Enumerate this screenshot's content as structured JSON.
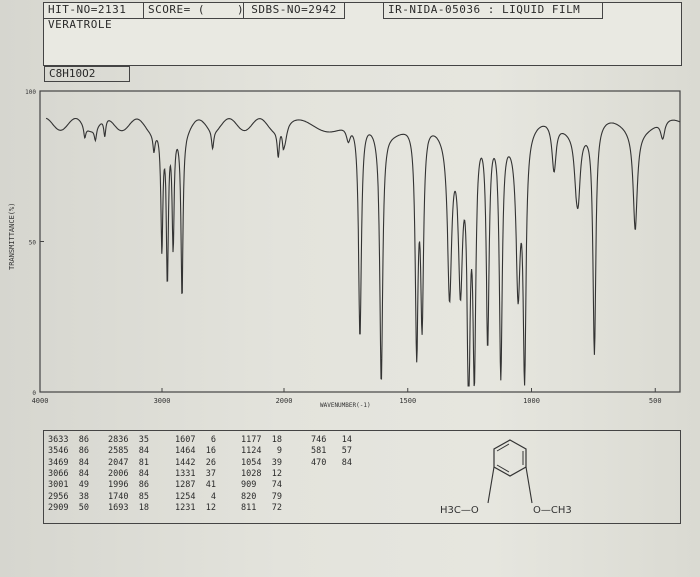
{
  "header": {
    "hit_no": "HIT-NO=2131",
    "score": "SCORE=  (",
    "sdbs": ") SDBS-NO=2942",
    "ir_nida": "IR-NIDA-05036 : LIQUID FILM",
    "compound": "VERATROLE",
    "formula": "C8H10O2"
  },
  "chart_data": {
    "type": "line",
    "xlabel": "WAVENUMBER(-1)",
    "ylabel": "TRANSMITTANCE(%)",
    "xlim": [
      4000,
      400
    ],
    "ylim": [
      0,
      100
    ],
    "x_ticks": [
      {
        "value": 4000,
        "label": "4000"
      },
      {
        "value": 3000,
        "label": "3000"
      },
      {
        "value": 2000,
        "label": "2000"
      },
      {
        "value": 1500,
        "label": "1500"
      },
      {
        "value": 1000,
        "label": "1000"
      },
      {
        "value": 500,
        "label": "500"
      }
    ],
    "y_ticks": [
      {
        "value": 100,
        "label": "100"
      },
      {
        "value": 50,
        "label": "50"
      },
      {
        "value": 0,
        "label": "0"
      }
    ],
    "peaks": [
      {
        "x": 3633,
        "y": 86
      },
      {
        "x": 3546,
        "y": 86
      },
      {
        "x": 3469,
        "y": 84
      },
      {
        "x": 3066,
        "y": 84
      },
      {
        "x": 3001,
        "y": 49
      },
      {
        "x": 2956,
        "y": 38
      },
      {
        "x": 2909,
        "y": 50
      },
      {
        "x": 2836,
        "y": 35
      },
      {
        "x": 2585,
        "y": 84
      },
      {
        "x": 2047,
        "y": 81
      },
      {
        "x": 2006,
        "y": 84
      },
      {
        "x": 1996,
        "y": 86
      },
      {
        "x": 1740,
        "y": 85
      },
      {
        "x": 1693,
        "y": 18
      },
      {
        "x": 1607,
        "y": 6
      },
      {
        "x": 1464,
        "y": 16
      },
      {
        "x": 1442,
        "y": 26
      },
      {
        "x": 1331,
        "y": 37
      },
      {
        "x": 1287,
        "y": 41
      },
      {
        "x": 1254,
        "y": 4
      },
      {
        "x": 1231,
        "y": 12
      },
      {
        "x": 1177,
        "y": 18
      },
      {
        "x": 1124,
        "y": 9
      },
      {
        "x": 1054,
        "y": 39
      },
      {
        "x": 1028,
        "y": 12
      },
      {
        "x": 909,
        "y": 74
      },
      {
        "x": 820,
        "y": 79
      },
      {
        "x": 811,
        "y": 72
      },
      {
        "x": 746,
        "y": 14
      },
      {
        "x": 581,
        "y": 57
      },
      {
        "x": 470,
        "y": 84
      }
    ],
    "peak_table": [
      [
        "3633",
        "86",
        "2836",
        "35",
        "1607",
        "6",
        "1177",
        "18",
        "746",
        "14"
      ],
      [
        "3546",
        "86",
        "2585",
        "84",
        "1464",
        "16",
        "1124",
        "9",
        "581",
        "57"
      ],
      [
        "3469",
        "84",
        "2047",
        "81",
        "1442",
        "26",
        "1054",
        "39",
        "470",
        "84"
      ],
      [
        "3066",
        "84",
        "2006",
        "84",
        "1331",
        "37",
        "1028",
        "12",
        "",
        ""
      ],
      [
        "3001",
        "49",
        "1996",
        "86",
        "1287",
        "41",
        "909",
        "74",
        "",
        ""
      ],
      [
        "2956",
        "38",
        "1740",
        "85",
        "1254",
        "4",
        "820",
        "79",
        "",
        ""
      ],
      [
        "2909",
        "50",
        "1693",
        "18",
        "1231",
        "12",
        "811",
        "72",
        "",
        ""
      ]
    ]
  },
  "structure": {
    "left_group": "H3C—O",
    "right_group": "O—CH3"
  }
}
